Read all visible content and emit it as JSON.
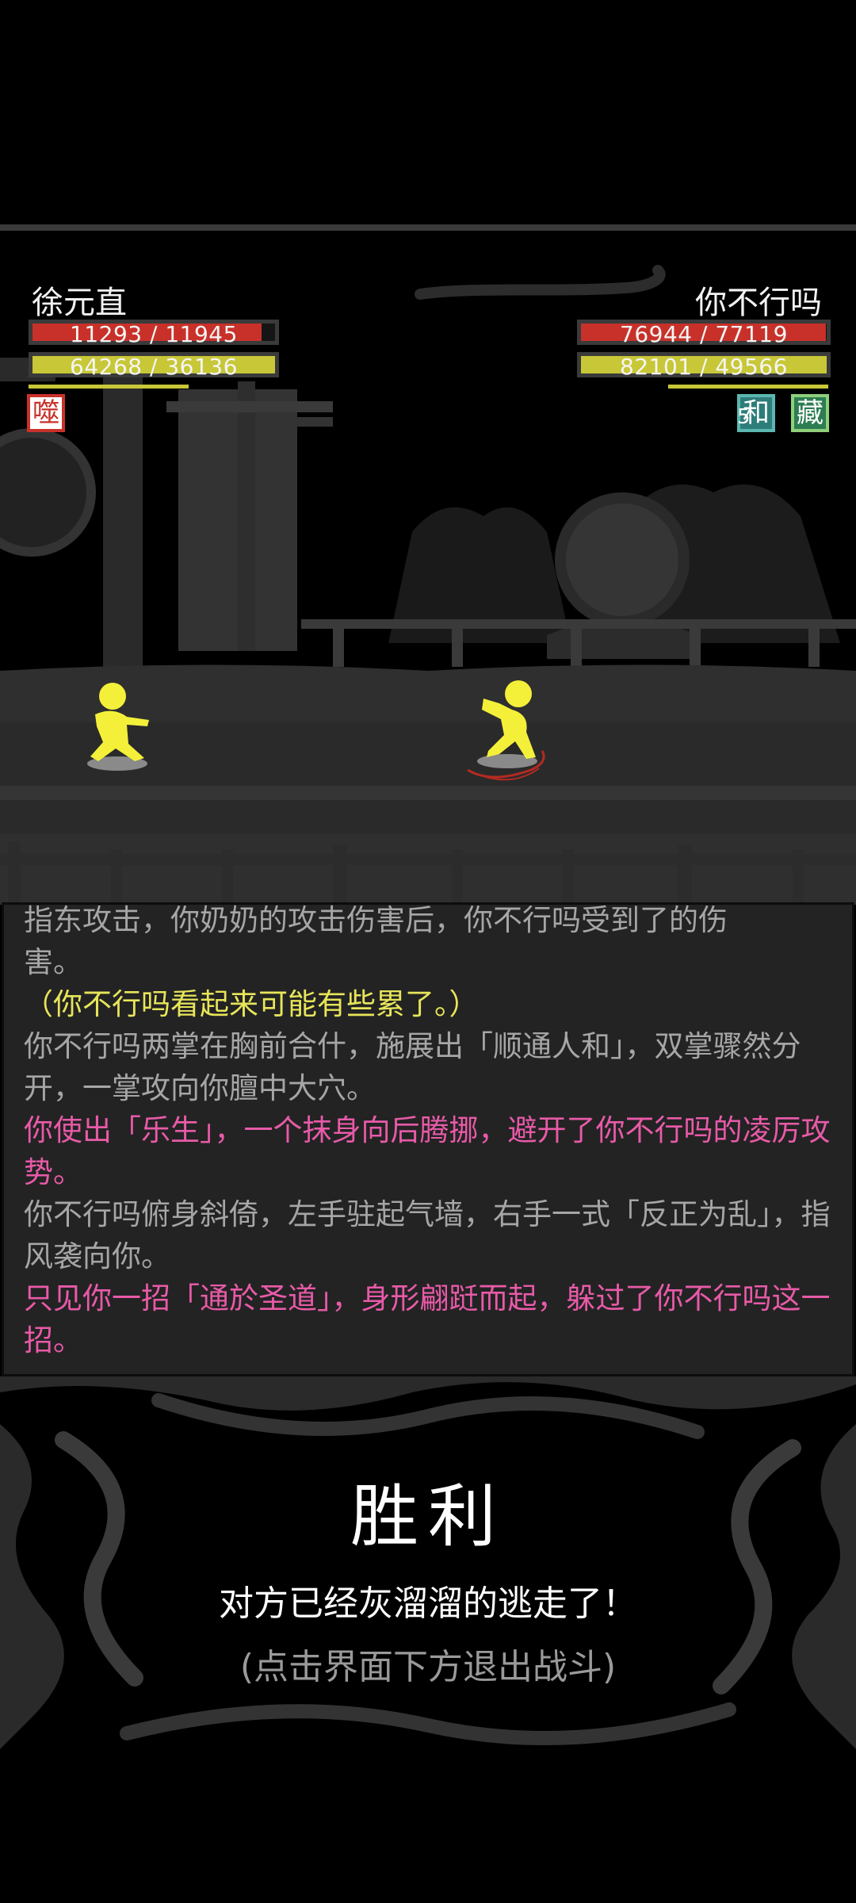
{
  "player": {
    "name": "徐元直",
    "hp_text": "11293 / 11945",
    "mp_text": "64268 / 36136",
    "hp_ratio": 0.945,
    "mp_ratio": 1.0,
    "stamina_ratio": 0.65,
    "status": {
      "glyph": "噬",
      "icon": "bite-status-icon"
    }
  },
  "enemy": {
    "name": "你不行吗",
    "hp_text": "76944 / 77119",
    "mp_text": "82101 / 49566",
    "hp_ratio": 0.998,
    "mp_ratio": 1.0,
    "stamina_ratio": 0.65,
    "statuses": [
      {
        "glyph": "和",
        "count": "5",
        "icon": "harmony-status-icon"
      },
      {
        "glyph": "藏",
        "icon": "hide-status-icon"
      }
    ]
  },
  "log": [
    {
      "text": "指东攻击，你奶奶的攻击伤害后，你不行吗受到了的伤",
      "style": "gray"
    },
    {
      "text": "害。",
      "style": "gray"
    },
    {
      "text": "（你不行吗看起来可能有些累了。）",
      "style": "yellow"
    },
    {
      "text": "你不行吗两掌在胸前合什，施展出「顺通人和」，双掌骤然分开，一掌攻向你膻中大穴。",
      "style": "gray"
    },
    {
      "text": "你使出「乐生」，一个抹身向后腾挪，避开了你不行吗的凌厉攻势。",
      "style": "pink"
    },
    {
      "text": "你不行吗俯身斜倚，左手驻起气墙，右手一式「反正为乱」，指风袭向你。",
      "style": "gray"
    },
    {
      "text": "只见你一招「通於圣道」，身形翩跹而起，躲过了你不行吗这一招。",
      "style": "pink"
    }
  ],
  "result": {
    "title": "胜利",
    "message": "对方已经灰溜溜的逃走了！",
    "hint": "(点击界面下方退出战斗)"
  },
  "colors": {
    "hp": "#c8312a",
    "mp": "#c7c738",
    "log_gray": "#a6a6a6",
    "log_yellow": "#e7e55a",
    "log_pink": "#e85aa8",
    "fighter": "#f4f03a"
  }
}
